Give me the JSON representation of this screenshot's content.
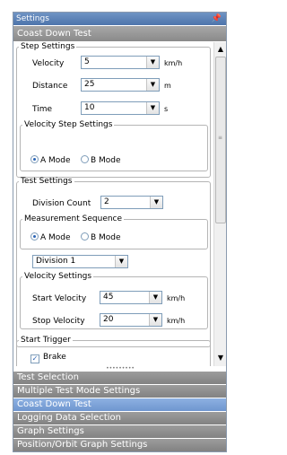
{
  "panel": {
    "title": "Settings",
    "pin_icon": "pin-icon"
  },
  "section": {
    "title": "Coast Down Test"
  },
  "step_settings": {
    "legend": "Step Settings",
    "rows": [
      {
        "label": "Velocity",
        "value": "5",
        "unit": "km/h"
      },
      {
        "label": "Distance",
        "value": "25",
        "unit": "m"
      },
      {
        "label": "Time",
        "value": "10",
        "unit": "s"
      }
    ],
    "mode_legend": "Velocity Step Settings",
    "mode_a": "A Mode",
    "mode_b": "B Mode",
    "selected_mode": "A Mode"
  },
  "test_settings": {
    "legend": "Test Settings",
    "division_count_label": "Division Count",
    "division_count_value": "2",
    "sequence_legend": "Measurement Sequence",
    "seq_a": "A Mode",
    "seq_b": "B Mode",
    "selected_sequence": "A Mode",
    "division_select_value": "Division 1",
    "velocity_legend": "Velocity Settings",
    "start_velocity_label": "Start Velocity",
    "start_velocity_value": "45",
    "start_velocity_unit": "km/h",
    "stop_velocity_label": "Stop Velocity",
    "stop_velocity_value": "20",
    "stop_velocity_unit": "km/h"
  },
  "start_trigger": {
    "legend": "Start Trigger",
    "brake_label": "Brake",
    "brake_checked": true
  },
  "nav_items": [
    {
      "label": "Test Selection",
      "active": false
    },
    {
      "label": "Multiple Test Mode Settings",
      "active": false
    },
    {
      "label": "Coast Down Test",
      "active": true
    },
    {
      "label": "Logging Data Selection",
      "active": false
    },
    {
      "label": "Graph Settings",
      "active": false
    },
    {
      "label": "Position/Orbit Graph Settings",
      "active": false
    }
  ],
  "colors": {
    "title_bar": "#4d74ab",
    "active_nav": "#7da3d9",
    "nav": "#8f8f8f",
    "radio_dot": "#2a64b6"
  }
}
